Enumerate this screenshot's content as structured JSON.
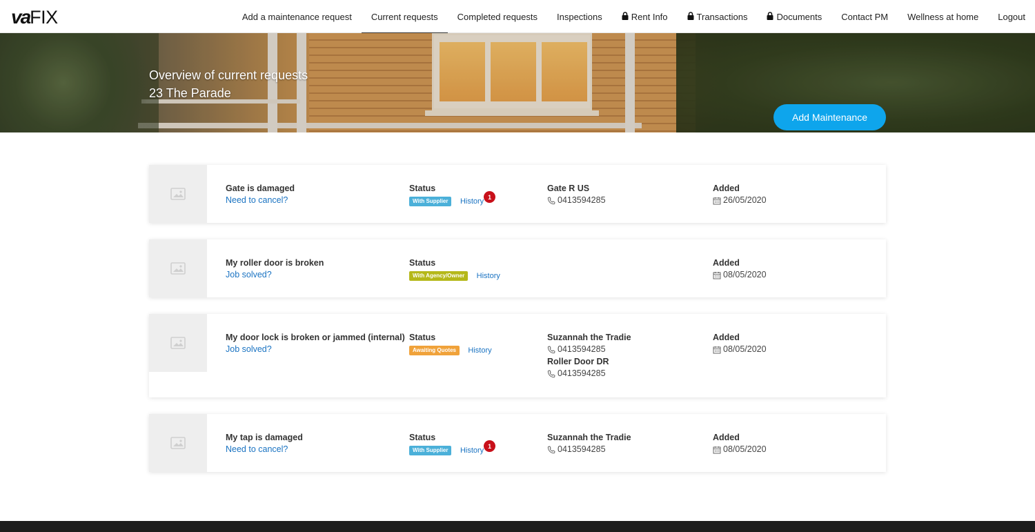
{
  "nav": {
    "logo": {
      "part1": "va",
      "part2": "FIX"
    },
    "items": [
      {
        "label": "Add a maintenance request",
        "locked": false,
        "active": false
      },
      {
        "label": "Current requests",
        "locked": false,
        "active": true
      },
      {
        "label": "Completed requests",
        "locked": false,
        "active": false
      },
      {
        "label": "Inspections",
        "locked": false,
        "active": false
      },
      {
        "label": "Rent Info",
        "locked": true,
        "active": false
      },
      {
        "label": "Transactions",
        "locked": true,
        "active": false
      },
      {
        "label": "Documents",
        "locked": true,
        "active": false
      },
      {
        "label": "Contact PM",
        "locked": false,
        "active": false
      },
      {
        "label": "Wellness at home",
        "locked": false,
        "active": false
      },
      {
        "label": "Logout",
        "locked": false,
        "active": false
      }
    ]
  },
  "hero": {
    "title": "Overview of current requests",
    "address": "23 The Parade",
    "button_label": "Add Maintenance"
  },
  "colors": {
    "accent": "#0ea5ec",
    "with_supplier": "#4bb0d9",
    "with_agency": "#b5b81a",
    "awaiting_quotes": "#f0a23a",
    "notification": "#c8101a"
  },
  "requests": [
    {
      "title": "Gate is damaged",
      "action": "Need to cancel?",
      "status_label": "Status",
      "status": "With Supplier",
      "history": "History",
      "notifications": "1",
      "contacts": [
        {
          "name": "Gate R US",
          "phone": "0413594285"
        }
      ],
      "added_label": "Added",
      "added": "26/05/2020"
    },
    {
      "title": "My roller door is broken",
      "action": "Job solved?",
      "status_label": "Status",
      "status": "With Agency/Owner",
      "history": "History",
      "contacts": [],
      "added_label": "Added",
      "added": "08/05/2020"
    },
    {
      "title": "My door lock is broken or jammed (internal)",
      "action": "Job solved?",
      "status_label": "Status",
      "status": "Awaiting Quotes",
      "history": "History",
      "contacts": [
        {
          "name": "Suzannah the Tradie",
          "phone": "0413594285"
        },
        {
          "name": "Roller Door DR",
          "phone": "0413594285"
        }
      ],
      "added_label": "Added",
      "added": "08/05/2020"
    },
    {
      "title": "My tap is damaged",
      "action": "Need to cancel?",
      "status_label": "Status",
      "status": "With Supplier",
      "history": "History",
      "notifications": "1",
      "contacts": [
        {
          "name": "Suzannah the Tradie",
          "phone": "0413594285"
        }
      ],
      "added_label": "Added",
      "added": "08/05/2020"
    }
  ]
}
